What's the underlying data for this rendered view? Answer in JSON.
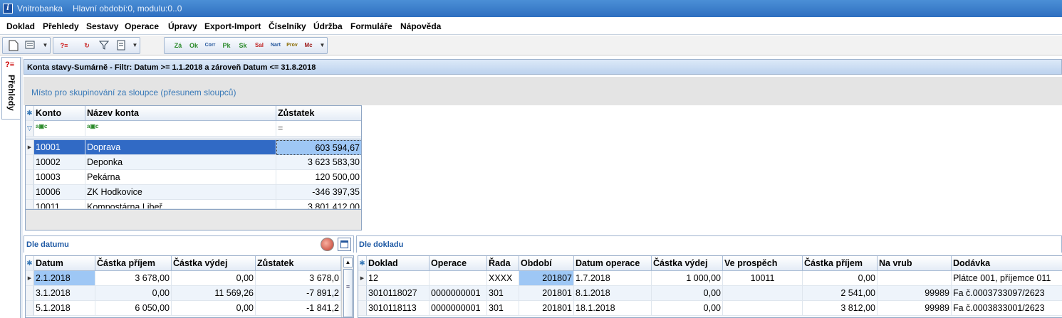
{
  "window": {
    "app_name": "Vnitrobanka",
    "subtitle": "Hlavní období:0, modulu:0..0"
  },
  "menu": [
    "Doklad",
    "Přehledy",
    "Sestavy",
    "Operace",
    "Úpravy",
    "Export-Import",
    "Číselníky",
    "Údržba",
    "Formuláře",
    "Nápověda"
  ],
  "toolbar": {
    "right_buttons": [
      "Zá",
      "Ok",
      "Corr",
      "Pk",
      "Sk",
      "Sal",
      "Nart",
      "Prov",
      "Mc"
    ]
  },
  "left_tab": {
    "label": "Přehledy"
  },
  "main": {
    "title": "Konta stavy-Sumárně  -  Filtr: Datum >= 1.1.2018  a zároveň  Datum <= 31.8.2018",
    "group_hint": "Místo pro skupinování za sloupce (přesunem sloupců)",
    "filter_eq": "="
  },
  "konta": {
    "columns": [
      "Konto",
      "Název konta",
      "Zůstatek"
    ],
    "rows": [
      [
        "10001",
        "Doprava",
        "603 594,67"
      ],
      [
        "10002",
        "Deponka",
        "3 623 583,30"
      ],
      [
        "10003",
        "Pekárna",
        "120 500,00"
      ],
      [
        "10006",
        "ZK Hodkovice",
        "-346 397,35"
      ],
      [
        "10011",
        "Kompostárna Libeř",
        "3 801 412,00"
      ]
    ]
  },
  "dle_datumu": {
    "title": "Dle datumu",
    "columns": [
      "Datum",
      "Částka příjem",
      "Částka výdej",
      "Zůstatek"
    ],
    "rows": [
      [
        "2.1.2018",
        "3 678,00",
        "0,00",
        "3 678,0"
      ],
      [
        "3.1.2018",
        "0,00",
        "11 569,26",
        "-7 891,2"
      ],
      [
        "5.1.2018",
        "6 050,00",
        "0,00",
        "-1 841,2"
      ]
    ]
  },
  "dle_dokladu": {
    "title": "Dle dokladu",
    "columns": [
      "Doklad",
      "Operace",
      "Řada",
      "Období",
      "Datum operace",
      "Částka výdej",
      "Ve prospěch",
      "Částka příjem",
      "Na vrub",
      "Dodávka"
    ],
    "rows": [
      [
        "12",
        "",
        "XXXX",
        "201807",
        "1.7.2018",
        "1 000,00",
        "10011",
        "0,00",
        "",
        "Plátce 001, příjemce 011"
      ],
      [
        "3010118027",
        "0000000001",
        "301",
        "201801",
        "8.1.2018",
        "0,00",
        "",
        "2 541,00",
        "99989",
        "Fa č.0003733097/2623"
      ],
      [
        "3010118113",
        "0000000001",
        "301",
        "201801",
        "18.1.2018",
        "0,00",
        "",
        "3 812,00",
        "99989",
        "Fa č.0003833001/2623"
      ]
    ]
  }
}
